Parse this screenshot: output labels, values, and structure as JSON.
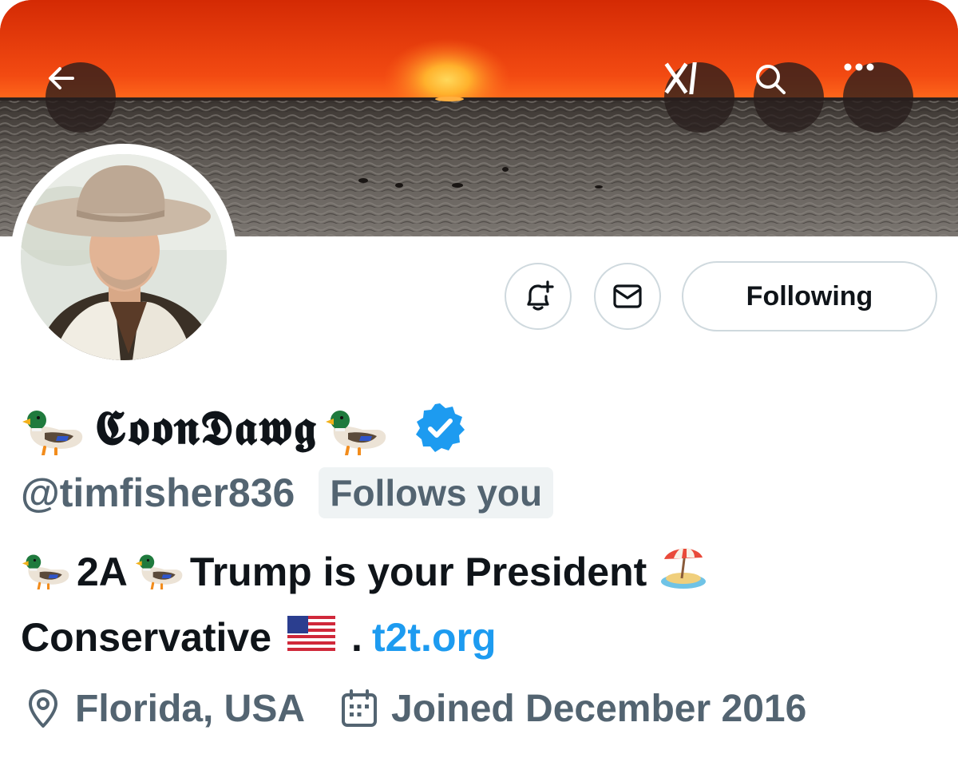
{
  "header": {
    "back_icon": "arrow-left-icon",
    "grok_icon": "grok-logo-icon",
    "search_icon": "search-icon",
    "more_icon": "more-horizontal-icon"
  },
  "profile": {
    "name_prefix_emoji": "🦆",
    "display_name": "𝕮𝖔𝖔𝖓𝕯𝖆𝖜𝖌",
    "name_suffix_emoji": "🦆",
    "verified_icon": "verified-badge-icon",
    "verified_color": "#1d9bf0",
    "handle": "@timfisher836",
    "follows_you": "Follows you"
  },
  "actions": {
    "notify_icon": "bell-plus-icon",
    "message_icon": "envelope-icon",
    "following_label": "Following"
  },
  "bio": {
    "line1": [
      {
        "type": "emoji",
        "text": "🦆"
      },
      {
        "type": "text",
        "text": "2A "
      },
      {
        "type": "emoji",
        "text": "🦆"
      },
      {
        "type": "text",
        "text": "Trump is your President "
      },
      {
        "type": "emoji",
        "text": "🏝️"
      }
    ],
    "line2_text": "Conservative",
    "line2_flag": "🇺🇸",
    "line2_dot": ".",
    "link": "t2t.org",
    "link_color": "#1d9bf0"
  },
  "meta": {
    "location_icon": "location-pin-icon",
    "location": "Florida, USA",
    "joined_icon": "calendar-icon",
    "joined": "Joined December 2016"
  },
  "colors": {
    "text_primary": "#0f1419",
    "text_secondary": "#536471",
    "border": "#cfd9de",
    "badge_bg": "#eff3f4"
  }
}
